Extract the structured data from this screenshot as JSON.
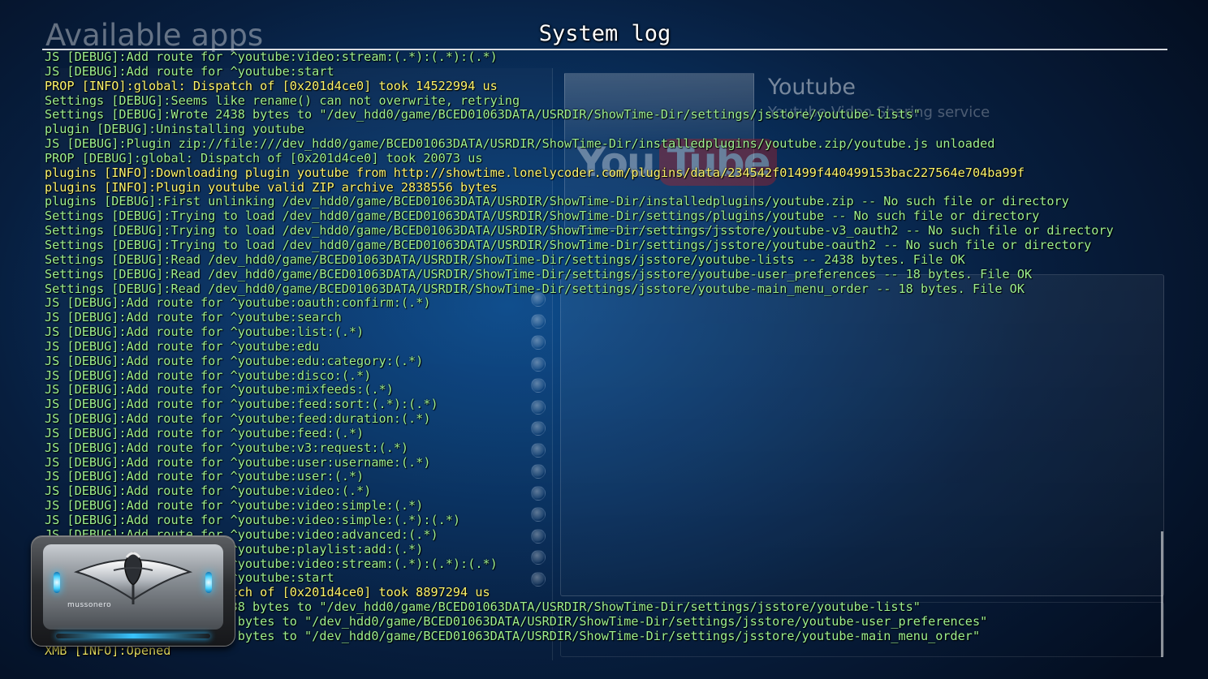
{
  "background_app": {
    "heading": "Available apps",
    "selected_app": {
      "title": "Youtube",
      "description": "Youtube Video Sharing service",
      "logo_you": "You",
      "logo_tube": "Tube"
    }
  },
  "log_panel": {
    "title": "System log",
    "colors": {
      "debug": "#9ef08e",
      "info": "#fcf36a"
    },
    "lines": [
      {
        "level": "debug",
        "text": "JS [DEBUG]:Add route for ^youtube:video:stream:(.*):(.*):(.*)"
      },
      {
        "level": "debug",
        "text": "JS [DEBUG]:Add route for ^youtube:start"
      },
      {
        "level": "info",
        "text": "PROP [INFO]:global: Dispatch of [0x201d4ce0] took 14522994 us"
      },
      {
        "level": "debug",
        "text": "Settings [DEBUG]:Seems like rename() can not overwrite, retrying"
      },
      {
        "level": "debug",
        "text": "Settings [DEBUG]:Wrote 2438 bytes to \"/dev_hdd0/game/BCED01063DATA/USRDIR/ShowTime-Dir/settings/jsstore/youtube-lists\""
      },
      {
        "level": "debug",
        "text": "plugin [DEBUG]:Uninstalling youtube"
      },
      {
        "level": "debug",
        "text": "JS [DEBUG]:Plugin zip://file:///dev_hdd0/game/BCED01063DATA/USRDIR/ShowTime-Dir/installedplugins/youtube.zip/youtube.js unloaded"
      },
      {
        "level": "debug",
        "text": "PROP [DEBUG]:global: Dispatch of [0x201d4ce0] took 20073 us"
      },
      {
        "level": "info",
        "text": "plugins [INFO]:Downloading plugin youtube from http://showtime.lonelycoder.com/plugins/data/234542f01499f440499153bac227564e704ba99f"
      },
      {
        "level": "info",
        "text": "plugins [INFO]:Plugin youtube valid ZIP archive 2838556 bytes"
      },
      {
        "level": "debug",
        "text": "plugins [DEBUG]:First unlinking /dev_hdd0/game/BCED01063DATA/USRDIR/ShowTime-Dir/installedplugins/youtube.zip -- No such file or directory"
      },
      {
        "level": "debug",
        "text": "Settings [DEBUG]:Trying to load /dev_hdd0/game/BCED01063DATA/USRDIR/ShowTime-Dir/settings/plugins/youtube -- No such file or directory"
      },
      {
        "level": "debug",
        "text": "Settings [DEBUG]:Trying to load /dev_hdd0/game/BCED01063DATA/USRDIR/ShowTime-Dir/settings/jsstore/youtube-v3_oauth2 -- No such file or directory"
      },
      {
        "level": "debug",
        "text": "Settings [DEBUG]:Trying to load /dev_hdd0/game/BCED01063DATA/USRDIR/ShowTime-Dir/settings/jsstore/youtube-oauth2 -- No such file or directory"
      },
      {
        "level": "debug",
        "text": "Settings [DEBUG]:Read /dev_hdd0/game/BCED01063DATA/USRDIR/ShowTime-Dir/settings/jsstore/youtube-lists -- 2438 bytes. File OK"
      },
      {
        "level": "debug",
        "text": "Settings [DEBUG]:Read /dev_hdd0/game/BCED01063DATA/USRDIR/ShowTime-Dir/settings/jsstore/youtube-user_preferences -- 18 bytes. File OK"
      },
      {
        "level": "debug",
        "text": "Settings [DEBUG]:Read /dev_hdd0/game/BCED01063DATA/USRDIR/ShowTime-Dir/settings/jsstore/youtube-main_menu_order -- 18 bytes. File OK"
      },
      {
        "level": "debug",
        "text": "JS [DEBUG]:Add route for ^youtube:oauth:confirm:(.*)"
      },
      {
        "level": "debug",
        "text": "JS [DEBUG]:Add route for ^youtube:search"
      },
      {
        "level": "debug",
        "text": "JS [DEBUG]:Add route for ^youtube:list:(.*)"
      },
      {
        "level": "debug",
        "text": "JS [DEBUG]:Add route for ^youtube:edu"
      },
      {
        "level": "debug",
        "text": "JS [DEBUG]:Add route for ^youtube:edu:category:(.*)"
      },
      {
        "level": "debug",
        "text": "JS [DEBUG]:Add route for ^youtube:disco:(.*)"
      },
      {
        "level": "debug",
        "text": "JS [DEBUG]:Add route for ^youtube:mixfeeds:(.*)"
      },
      {
        "level": "debug",
        "text": "JS [DEBUG]:Add route for ^youtube:feed:sort:(.*):(.*)"
      },
      {
        "level": "debug",
        "text": "JS [DEBUG]:Add route for ^youtube:feed:duration:(.*)"
      },
      {
        "level": "debug",
        "text": "JS [DEBUG]:Add route for ^youtube:feed:(.*)"
      },
      {
        "level": "debug",
        "text": "JS [DEBUG]:Add route for ^youtube:v3:request:(.*)"
      },
      {
        "level": "debug",
        "text": "JS [DEBUG]:Add route for ^youtube:user:username:(.*)"
      },
      {
        "level": "debug",
        "text": "JS [DEBUG]:Add route for ^youtube:user:(.*)"
      },
      {
        "level": "debug",
        "text": "JS [DEBUG]:Add route for ^youtube:video:(.*)"
      },
      {
        "level": "debug",
        "text": "JS [DEBUG]:Add route for ^youtube:video:simple:(.*)"
      },
      {
        "level": "debug",
        "text": "JS [DEBUG]:Add route for ^youtube:video:simple:(.*):(.*)"
      },
      {
        "level": "debug",
        "text": "JS [DEBUG]:Add route for ^youtube:video:advanced:(.*)"
      },
      {
        "level": "debug",
        "text": "JS [DEBUG]:Add route for ^youtube:playlist:add:(.*)"
      },
      {
        "level": "debug",
        "text": "JS [DEBUG]:Add route for ^youtube:video:stream:(.*):(.*):(.*)"
      },
      {
        "level": "debug",
        "text": "JS [DEBUG]:Add route for ^youtube:start"
      },
      {
        "level": "info",
        "text": "PROP [INFO]:global: Dispatch of [0x201d4ce0] took 8897294 us"
      },
      {
        "level": "debug",
        "text": "Settings [DEBUG]:Wrote 2438 bytes to \"/dev_hdd0/game/BCED01063DATA/USRDIR/ShowTime-Dir/settings/jsstore/youtube-lists\""
      },
      {
        "level": "debug",
        "text": "Settings [DEBUG]:Wrote 18 bytes to \"/dev_hdd0/game/BCED01063DATA/USRDIR/ShowTime-Dir/settings/jsstore/youtube-user_preferences\""
      },
      {
        "level": "debug",
        "text": "Settings [DEBUG]:Wrote 18 bytes to \"/dev_hdd0/game/BCED01063DATA/USRDIR/ShowTime-Dir/settings/jsstore/youtube-main_menu_order\""
      },
      {
        "level": "info",
        "text": "XMB [INFO]:Opened"
      }
    ]
  },
  "launcher_badge": {
    "label": "mussonero",
    "icon": "cobra-emblem-icon"
  }
}
